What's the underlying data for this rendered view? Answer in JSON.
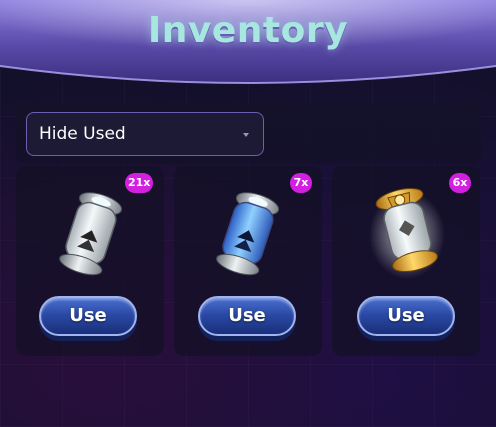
{
  "header": {
    "title": "Inventory"
  },
  "filter": {
    "selected": "Hide Used"
  },
  "items": [
    {
      "icon": "silver-lantern-icon",
      "count": "21x",
      "use_label": "Use"
    },
    {
      "icon": "blue-lantern-icon",
      "count": "7x",
      "use_label": "Use"
    },
    {
      "icon": "gold-lantern-icon",
      "count": "6x",
      "use_label": "Use"
    }
  ],
  "colors": {
    "badge": "#d21fe0",
    "title": "#a8e6e0",
    "button": "#2b4aa5",
    "header": "#5a4aa8"
  }
}
